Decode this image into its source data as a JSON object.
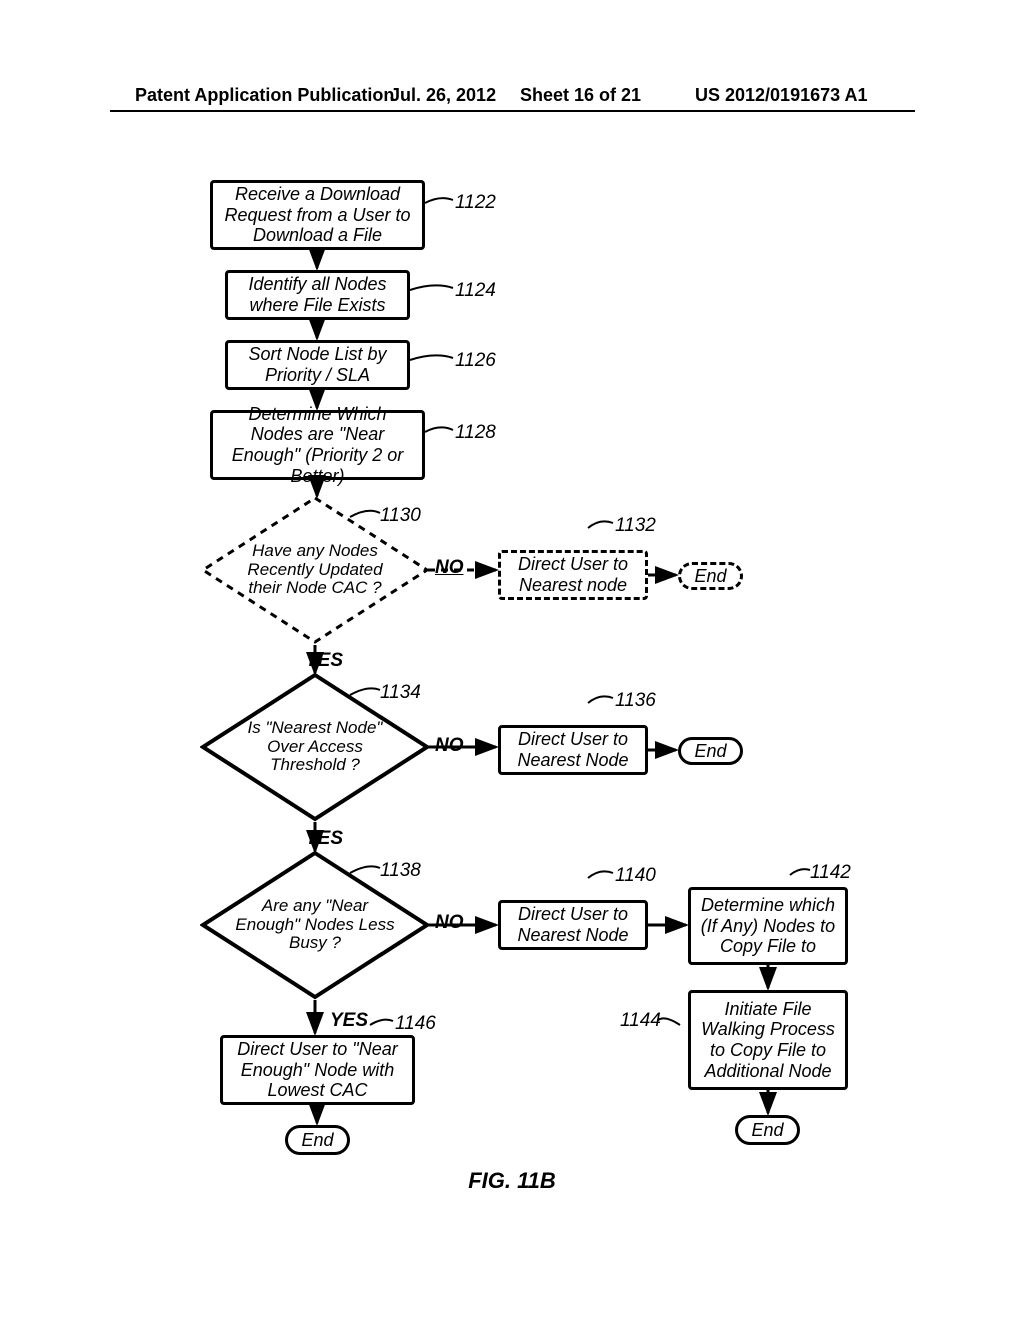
{
  "header": {
    "left": "Patent Application Publication",
    "date": "Jul. 26, 2012",
    "sheet": "Sheet 16 of 21",
    "pubno": "US 2012/0191673 A1"
  },
  "figure_label": "FIG. 11B",
  "refs": {
    "r1122": "1122",
    "r1124": "1124",
    "r1126": "1126",
    "r1128": "1128",
    "r1130": "1130",
    "r1132": "1132",
    "r1134": "1134",
    "r1136": "1136",
    "r1138": "1138",
    "r1140": "1140",
    "r1142": "1142",
    "r1144": "1144",
    "r1146": "1146"
  },
  "steps": {
    "s1122": "Receive a Download Request from a User to Download a File",
    "s1124": "Identify all Nodes where File Exists",
    "s1126": "Sort Node List by Priority / SLA",
    "s1128": "Determine Which Nodes are \"Near Enough\" (Priority 2 or Better)",
    "d1130": "Have any Nodes Recently Updated their Node CAC ?",
    "s1132": "Direct User to Nearest node",
    "end1": "End",
    "d1134": "Is \"Nearest Node\" Over Access Threshold ?",
    "s1136": "Direct User to Nearest Node",
    "end2": "End",
    "d1138": "Are any \"Near Enough\" Nodes Less Busy ?",
    "s1140": "Direct User to Nearest Node",
    "s1142": "Determine which (If Any) Nodes to Copy File to",
    "s1144": "Initiate File Walking Process to Copy File to Additional Node",
    "s1146": "Direct User to \"Near Enough\" Node with Lowest CAC",
    "end3": "End",
    "end4": "End"
  },
  "branch": {
    "yes": "YES",
    "no": "NO"
  }
}
